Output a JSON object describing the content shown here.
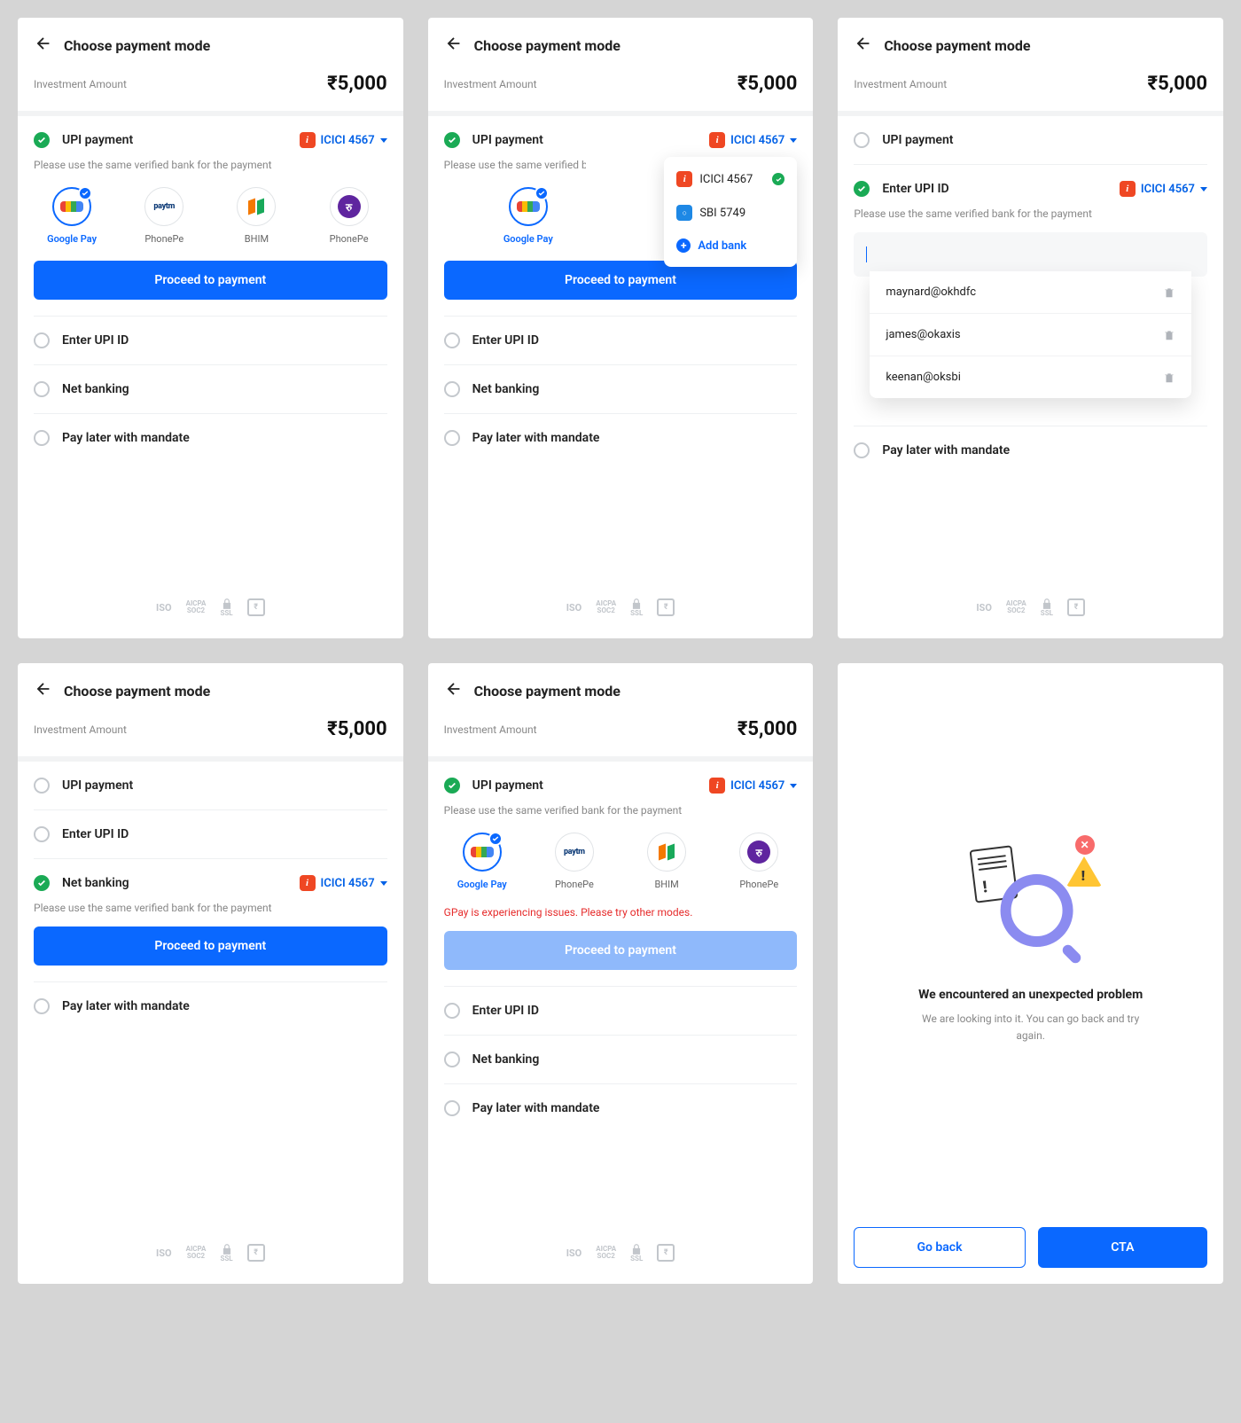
{
  "header": {
    "title": "Choose payment mode"
  },
  "amount": {
    "label": "Investment Amount",
    "value": "₹5,000"
  },
  "bank": {
    "label": "ICICI 4567"
  },
  "bankDropdown": {
    "items": [
      {
        "label": "ICICI 4567"
      },
      {
        "label": "SBI 5749"
      }
    ],
    "add": "Add bank"
  },
  "upi": {
    "title": "UPI payment",
    "help": "Please use the same verified bank for the payment",
    "apps": {
      "gpay": "Google Pay",
      "phonepe1": "PhonePe",
      "bhim": "BHIM",
      "phonepe2": "PhonePe"
    },
    "proceed": "Proceed to payment",
    "error": "GPay is experiencing issues. Please try other modes."
  },
  "upiId": {
    "title": "Enter UPI ID",
    "suggestions": [
      {
        "value": "maynard@okhdfc"
      },
      {
        "value": "james@okaxis"
      },
      {
        "value": "keenan@oksbi"
      }
    ]
  },
  "netbanking": {
    "title": "Net banking"
  },
  "paylater": {
    "title": "Pay later with mandate"
  },
  "errorScreen": {
    "title": "We encountered an unexpected problem",
    "sub": "We are looking into it. You can go back and try again.",
    "goBack": "Go back",
    "cta": "CTA"
  }
}
